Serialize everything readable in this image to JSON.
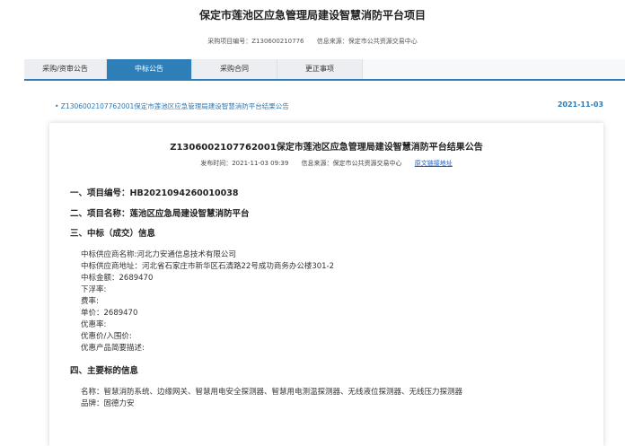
{
  "page": {
    "title": "保定市莲池区应急管理局建设智慧消防平台项目",
    "project_no": "采购项目编号：Z130600210776",
    "source": "信息来源：保定市公共资源交易中心"
  },
  "tabs": [
    {
      "label": "采购/资审公告"
    },
    {
      "label": "中标公告"
    },
    {
      "label": "采购合同"
    },
    {
      "label": "更正事项"
    }
  ],
  "notice": {
    "link": "• Z1306002107762001保定市莲池区应急管理局建设智慧消防平台结果公告",
    "date": "2021-11-03"
  },
  "card": {
    "title": "Z1306002107762001保定市莲池区应急管理局建设智慧消防平台结果公告",
    "publish_time": "发布时间：2021-11-03 09:39",
    "source": "信息来源：保定市公共资源交易中心",
    "original_link": "原文链接地址",
    "sections": {
      "s1": "一、项目编号：HB2021094260010038",
      "s2": "二、项目名称：莲池区应急局建设智慧消防平台",
      "s3": "三、中标（成交）信息",
      "s4": "四、主要标的信息"
    },
    "award": {
      "supplier": "中标供应商名称:河北力安通信息技术有限公司",
      "address": "中标供应商地址：河北省石家庄市新华区石清路22号成功商务办公楼301-2",
      "amount": "中标金额：2689470",
      "float_rate": "下浮率:",
      "fee_rate": "费率:",
      "unit_price": "单价：2689470",
      "discount_rate": "优惠率:",
      "discount_price": "优惠价/入围价:",
      "discount_desc": "优惠产品简要描述:"
    },
    "items": {
      "name": "名称：智慧消防系统、边缘网关、智慧用电安全探测器、智慧用电测温探测器、无线液位探测器、无线压力探测器",
      "brand": "品牌：固德力安"
    }
  }
}
